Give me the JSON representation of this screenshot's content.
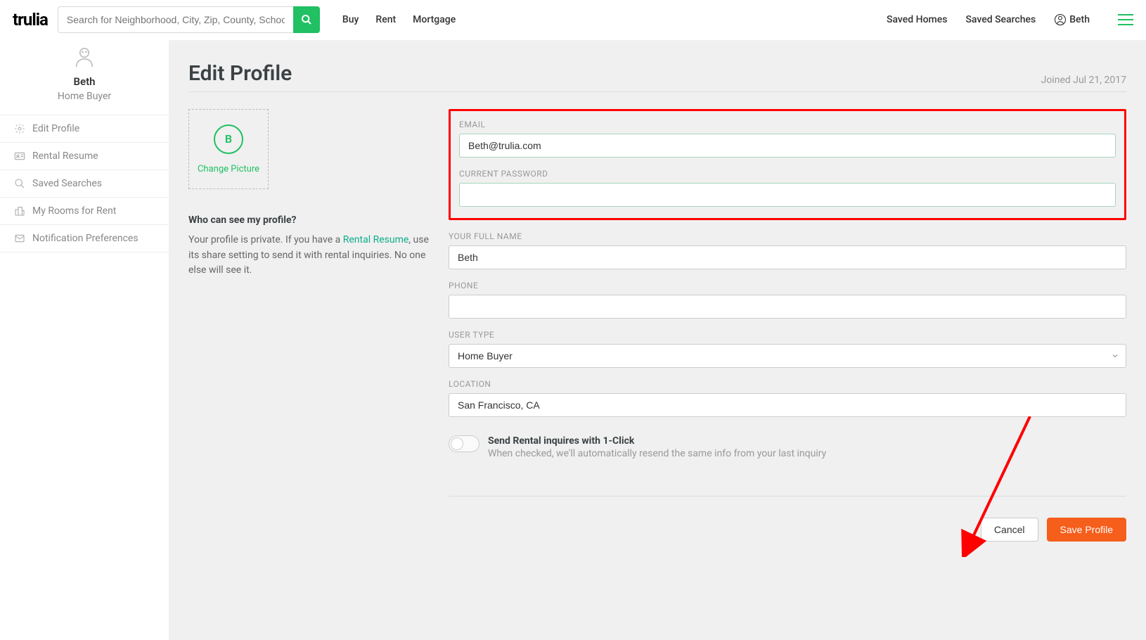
{
  "header": {
    "logo_text": "trulia",
    "search_placeholder": "Search for Neighborhood, City, Zip, County, School",
    "nav": {
      "buy": "Buy",
      "rent": "Rent",
      "mortgage": "Mortgage"
    },
    "saved_homes": "Saved Homes",
    "saved_searches": "Saved Searches",
    "user_label": "Beth"
  },
  "sidebar": {
    "user_name": "Beth",
    "user_role": "Home Buyer",
    "items": {
      "edit_profile": "Edit Profile",
      "rental_resume": "Rental Resume",
      "saved_searches": "Saved Searches",
      "my_rooms": "My Rooms for Rent",
      "notification_prefs": "Notification Preferences"
    }
  },
  "main": {
    "title": "Edit Profile",
    "joined": "Joined Jul 21, 2017",
    "pic_initial": "B",
    "pic_label": "Change Picture",
    "privacy_heading": "Who can see my profile?",
    "privacy_text_before": "Your profile is private. If you have a ",
    "privacy_link": "Rental Resume",
    "privacy_text_after": ", use its share setting to send it with rental inquiries. No one else will see it.",
    "labels": {
      "email": "EMAIL",
      "password": "CURRENT PASSWORD",
      "full_name": "YOUR FULL NAME",
      "phone": "PHONE",
      "user_type": "USER TYPE",
      "location": "LOCATION"
    },
    "values": {
      "email": "Beth@trulia.com",
      "password": "",
      "full_name": "Beth",
      "phone": "",
      "user_type": "Home Buyer",
      "location": "San Francisco, CA"
    },
    "toggle_title": "Send Rental inquires with 1-Click",
    "toggle_sub": "When checked, we'll automatically resend the same info from your last inquiry",
    "cancel": "Cancel",
    "save": "Save Profile"
  }
}
